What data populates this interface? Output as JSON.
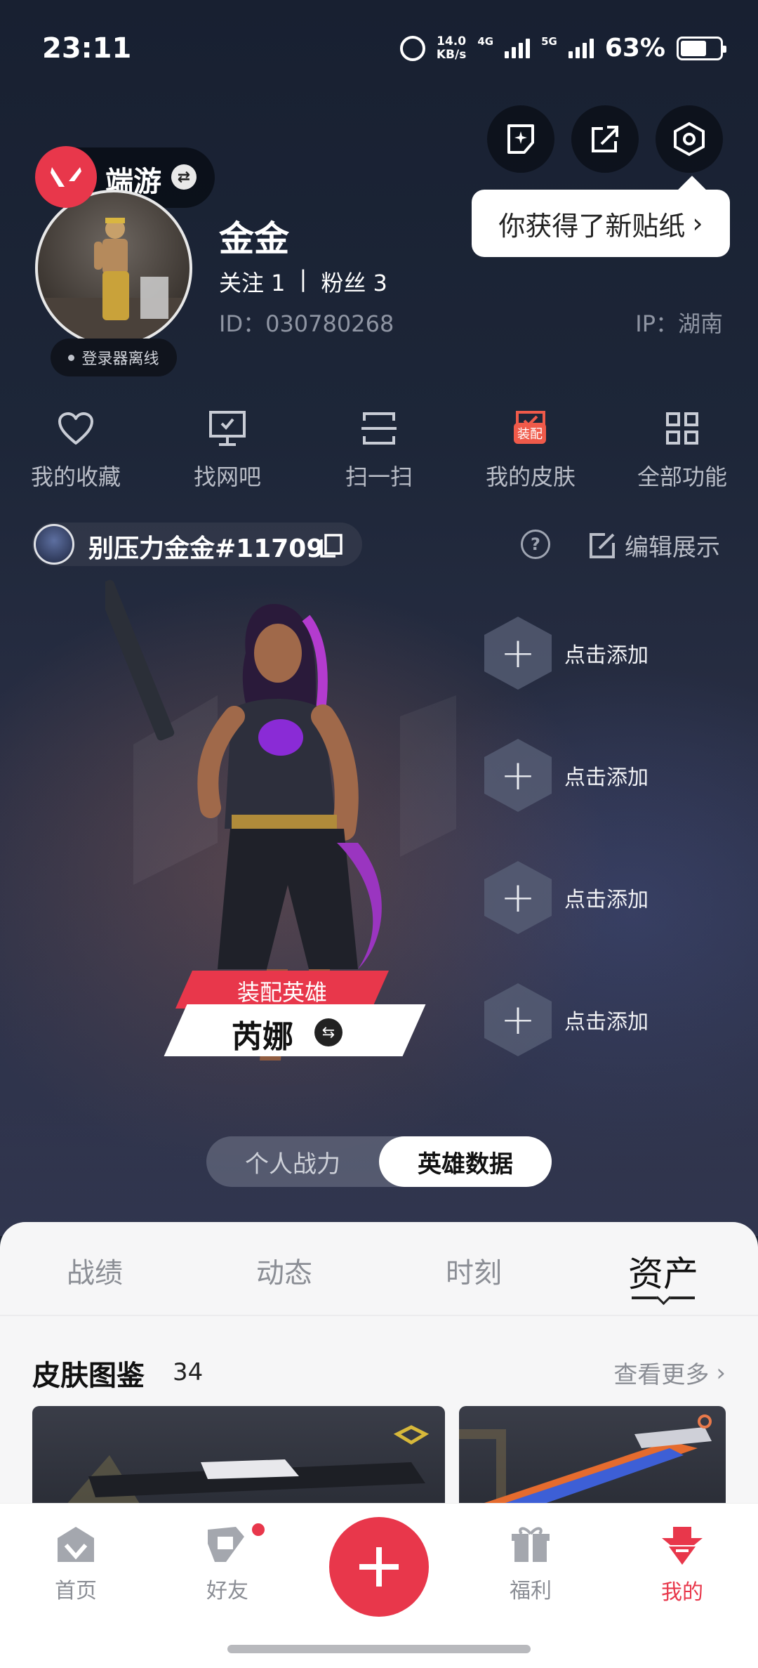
{
  "status_bar": {
    "time": "23:11",
    "speed_value": "14.0",
    "speed_unit": "KB/s",
    "net1": "4G",
    "net2": "5G",
    "battery": "63%"
  },
  "header": {
    "tooltip": "你获得了新贴纸",
    "game_name": "端游",
    "login_status": "登录器离线"
  },
  "profile": {
    "name": "金金",
    "follow": "关注 1",
    "separator": "|",
    "fans": "粉丝 3",
    "id": "ID：030780268",
    "ip": "IP：湖南"
  },
  "quick_actions": [
    {
      "label": "我的收藏",
      "icon": "heart-icon"
    },
    {
      "label": "找网吧",
      "icon": "monitor-icon"
    },
    {
      "label": "扫一扫",
      "icon": "scan-icon"
    },
    {
      "label": "我的皮肤",
      "icon": "skin-icon",
      "tag": "装配"
    },
    {
      "label": "全部功能",
      "icon": "grid-icon"
    }
  ],
  "player": {
    "tag": "别压力金金#11709",
    "help": "?",
    "edit": "编辑展示"
  },
  "hero": {
    "equip_label": "装配英雄",
    "name": "芮娜",
    "slots": [
      "点击添加",
      "点击添加",
      "点击添加",
      "点击添加"
    ]
  },
  "toggle": {
    "left": "个人战力",
    "right": "英雄数据"
  },
  "tabs": [
    "战绩",
    "动态",
    "时刻",
    "资产"
  ],
  "skins": {
    "title": "皮肤图鉴",
    "count": "34",
    "more": "查看更多"
  },
  "bottom_nav": {
    "home": "首页",
    "friends": "好友",
    "welfare": "福利",
    "mine": "我的"
  },
  "colors": {
    "accent": "#e8374b",
    "panel": "#f6f6f7"
  }
}
